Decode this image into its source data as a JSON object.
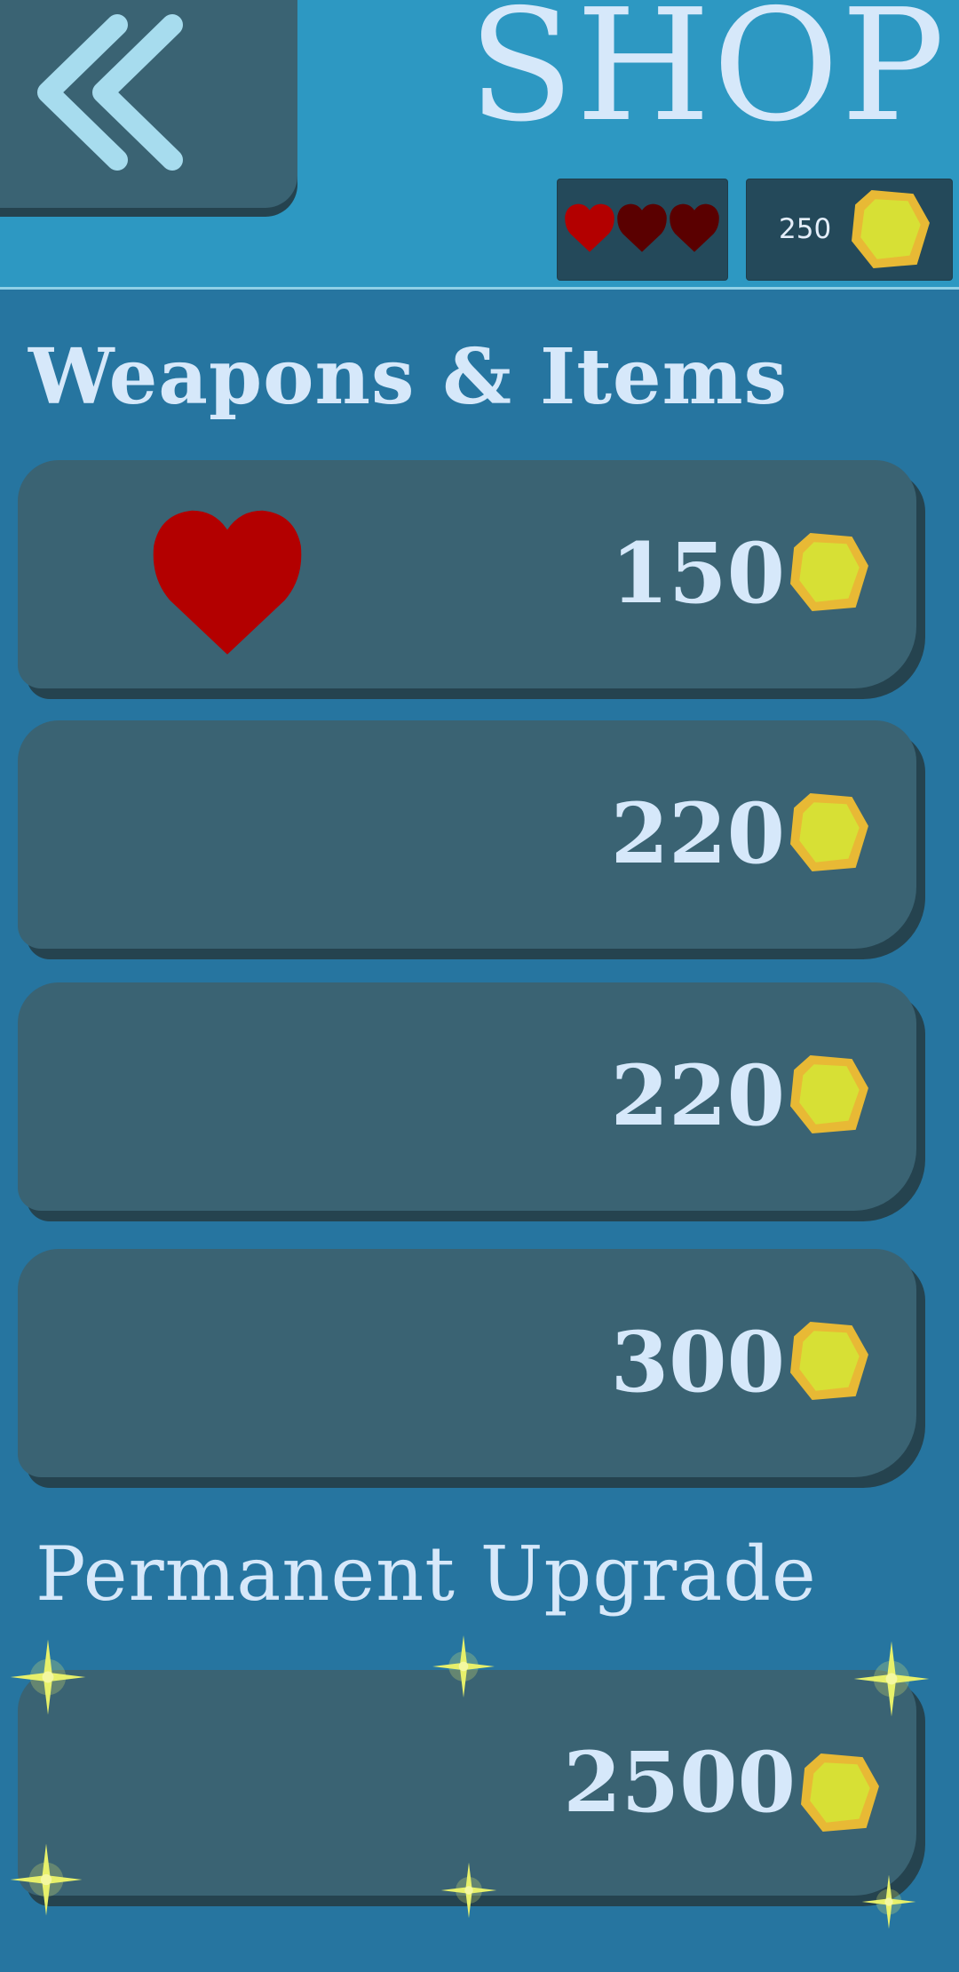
{
  "header": {
    "title": "SHOP",
    "hearts": {
      "filled": 1,
      "total": 3
    },
    "coins": "250"
  },
  "sections": {
    "weapons_title": "Weapons & Items",
    "permanent_title": "Permanent Upgrade"
  },
  "items": [
    {
      "price": "150",
      "icon": "heart-icon"
    },
    {
      "price": "220"
    },
    {
      "price": "220"
    },
    {
      "price": "300"
    }
  ],
  "upgrade": {
    "price": "2500"
  },
  "icons": {
    "back": "double-chevron-left-icon",
    "coin": "coin-icon",
    "heart": "heart-icon",
    "sparkle": "sparkle-icon"
  },
  "colors": {
    "background": "#2675a0",
    "header": "#2d98c2",
    "card": "#3a6373",
    "text": "#d6e8fa",
    "heart_full": "#b30000",
    "heart_empty": "#5a0000",
    "coin_outer": "#e8b935",
    "coin_inner": "#d7e035"
  }
}
